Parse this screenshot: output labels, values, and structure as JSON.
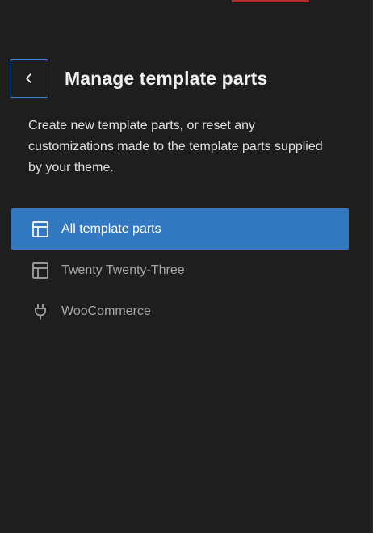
{
  "header": {
    "back_icon": "chevron-left-icon",
    "title": "Manage template parts"
  },
  "description": "Create new template parts, or reset any customizations made to the template parts supplied by your theme.",
  "nav": {
    "items": [
      {
        "label": "All template parts",
        "icon": "layout-icon",
        "active": true
      },
      {
        "label": "Twenty Twenty-Three",
        "icon": "layout-icon",
        "active": false
      },
      {
        "label": "WooCommerce",
        "icon": "plugin-icon",
        "active": false
      }
    ]
  },
  "colors": {
    "background": "#1e1e1e",
    "accent": "#3379c2",
    "focus_border": "#3a86d4",
    "top_accent": "#b32d2e"
  }
}
